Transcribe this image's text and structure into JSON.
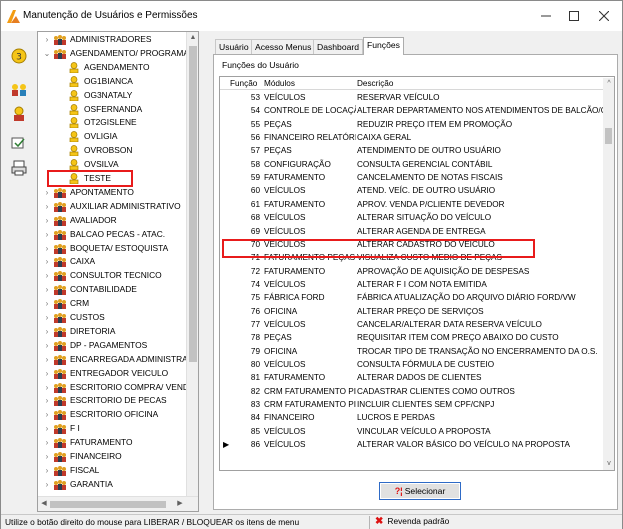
{
  "window": {
    "title": "Manutenção de Usuários e Permissões",
    "accent": "#f39c12"
  },
  "tree": {
    "items": [
      {
        "label": "ADMINISTRADORES",
        "level": 0,
        "state": "collapsed",
        "icon": "group-icon"
      },
      {
        "label": "AGENDAMENTO/ PROGRAMAD",
        "level": 0,
        "state": "expanded",
        "icon": "group-icon"
      },
      {
        "label": "AGENDAMENTO",
        "level": 1,
        "state": "leaf",
        "icon": "user-icon"
      },
      {
        "label": "OG1BIANCA",
        "level": 1,
        "state": "leaf",
        "icon": "user-icon"
      },
      {
        "label": "OG3NATALY",
        "level": 1,
        "state": "leaf",
        "icon": "user-icon"
      },
      {
        "label": "OSFERNANDA",
        "level": 1,
        "state": "leaf",
        "icon": "user-icon"
      },
      {
        "label": "OT2GISLENE",
        "level": 1,
        "state": "leaf",
        "icon": "user-icon"
      },
      {
        "label": "OVLIGIA",
        "level": 1,
        "state": "leaf",
        "icon": "user-icon"
      },
      {
        "label": "OVROBSON",
        "level": 1,
        "state": "leaf",
        "icon": "user-icon"
      },
      {
        "label": "OVSILVA",
        "level": 1,
        "state": "leaf",
        "icon": "user-icon"
      },
      {
        "label": "TESTE",
        "level": 1,
        "state": "leaf",
        "icon": "user-icon",
        "highlighted": true
      },
      {
        "label": "APONTAMENTO",
        "level": 0,
        "state": "collapsed",
        "icon": "group-icon"
      },
      {
        "label": "AUXILIAR ADMINISTRATIVO",
        "level": 0,
        "state": "collapsed",
        "icon": "group-icon"
      },
      {
        "label": "AVALIADOR",
        "level": 0,
        "state": "collapsed",
        "icon": "group-icon"
      },
      {
        "label": "BALCAO PECAS - ATAC.",
        "level": 0,
        "state": "collapsed",
        "icon": "group-icon"
      },
      {
        "label": "BOQUETA/ ESTOQUISTA",
        "level": 0,
        "state": "collapsed",
        "icon": "group-icon"
      },
      {
        "label": "CAIXA",
        "level": 0,
        "state": "collapsed",
        "icon": "group-icon"
      },
      {
        "label": "CONSULTOR TECNICO",
        "level": 0,
        "state": "collapsed",
        "icon": "group-icon"
      },
      {
        "label": "CONTABILIDADE",
        "level": 0,
        "state": "collapsed",
        "icon": "group-icon"
      },
      {
        "label": "CRM",
        "level": 0,
        "state": "collapsed",
        "icon": "group-icon"
      },
      {
        "label": "CUSTOS",
        "level": 0,
        "state": "collapsed",
        "icon": "group-icon"
      },
      {
        "label": "DIRETORIA",
        "level": 0,
        "state": "collapsed",
        "icon": "group-icon"
      },
      {
        "label": "DP - PAGAMENTOS",
        "level": 0,
        "state": "collapsed",
        "icon": "group-icon"
      },
      {
        "label": "ENCARREGADA ADMINISTRAT",
        "level": 0,
        "state": "collapsed",
        "icon": "group-icon"
      },
      {
        "label": "ENTREGADOR VEICULO",
        "level": 0,
        "state": "collapsed",
        "icon": "group-icon"
      },
      {
        "label": "ESCRITORIO COMPRA/ VENDA",
        "level": 0,
        "state": "collapsed",
        "icon": "group-icon"
      },
      {
        "label": "ESCRITORIO DE PECAS",
        "level": 0,
        "state": "collapsed",
        "icon": "group-icon"
      },
      {
        "label": "ESCRITORIO OFICINA",
        "level": 0,
        "state": "collapsed",
        "icon": "group-icon"
      },
      {
        "label": "F I",
        "level": 0,
        "state": "collapsed",
        "icon": "group-icon"
      },
      {
        "label": "FATURAMENTO",
        "level": 0,
        "state": "collapsed",
        "icon": "group-icon"
      },
      {
        "label": "FINANCEIRO",
        "level": 0,
        "state": "collapsed",
        "icon": "group-icon"
      },
      {
        "label": "FISCAL",
        "level": 0,
        "state": "collapsed",
        "icon": "group-icon"
      },
      {
        "label": "GARANTIA",
        "level": 0,
        "state": "collapsed",
        "icon": "group-icon"
      }
    ]
  },
  "tabs": [
    {
      "label": "Usuário",
      "active": false
    },
    {
      "label": "Acesso Menus",
      "active": false
    },
    {
      "label": "Dashboard",
      "active": false
    },
    {
      "label": "Funções",
      "active": true
    }
  ],
  "panel": {
    "title": "Funções do Usuário"
  },
  "grid": {
    "headers": {
      "num": "Função",
      "mod": "Módulos",
      "desc": "Descrição"
    },
    "rows": [
      {
        "num": "53",
        "mod": "VEÍCULOS",
        "desc": "RESERVAR VEÍCULO"
      },
      {
        "num": "54",
        "mod": "CONTROLE DE LOCAÇÃO",
        "desc": "ALTERAR DEPARTAMENTO NOS ATENDIMENTOS DE BALCÃO/OF"
      },
      {
        "num": "55",
        "mod": "PEÇAS",
        "desc": "REDUZIR PREÇO ITEM EM PROMOÇÃO"
      },
      {
        "num": "56",
        "mod": "FINANCEIRO RELATÓRIOS",
        "desc": "CAIXA GERAL"
      },
      {
        "num": "57",
        "mod": "PEÇAS",
        "desc": "ATENDIMENTO DE OUTRO USUÁRIO"
      },
      {
        "num": "58",
        "mod": "CONFIGURAÇÃO",
        "desc": "CONSULTA GERENCIAL CONTÁBIL"
      },
      {
        "num": "59",
        "mod": "FATURAMENTO",
        "desc": "CANCELAMENTO DE NOTAS FISCAIS"
      },
      {
        "num": "60",
        "mod": "VEÍCULOS",
        "desc": "ATEND. VEÍC. DE OUTRO USUÁRIO"
      },
      {
        "num": "61",
        "mod": "FATURAMENTO",
        "desc": "APROV. VENDA P/CLIENTE DEVEDOR"
      },
      {
        "num": "68",
        "mod": "VEÍCULOS",
        "desc": "ALTERAR SITUAÇÃO DO VEÍCULO"
      },
      {
        "num": "69",
        "mod": "VEÍCULOS",
        "desc": "ALTERAR AGENDA DE ENTREGA"
      },
      {
        "num": "70",
        "mod": "VEÍCULOS",
        "desc": "ALTERAR CADASTRO DO VEÍCULO",
        "highlighted": true
      },
      {
        "num": "71",
        "mod": "FATURAMENTO PEÇAS",
        "desc": "VISUALIZA CUSTO MEDIO DE PEÇAS"
      },
      {
        "num": "72",
        "mod": "FATURAMENTO",
        "desc": "APROVAÇÃO DE AQUISIÇÃO DE DESPESAS"
      },
      {
        "num": "74",
        "mod": "VEÍCULOS",
        "desc": "ALTERAR F I COM NOTA EMITIDA"
      },
      {
        "num": "75",
        "mod": "FÁBRICA FORD",
        "desc": "FÁBRICA ATUALIZAÇÃO DO ARQUIVO DIÁRIO FORD/VW"
      },
      {
        "num": "76",
        "mod": "OFICINA",
        "desc": "ALTERAR PREÇO DE SERVIÇOS"
      },
      {
        "num": "77",
        "mod": "VEÍCULOS",
        "desc": "CANCELAR/ALTERAR DATA RESERVA VEÍCULO"
      },
      {
        "num": "78",
        "mod": "PEÇAS",
        "desc": "REQUISITAR ITEM COM PREÇO ABAIXO DO CUSTO"
      },
      {
        "num": "79",
        "mod": "OFICINA",
        "desc": "TROCAR TIPO DE TRANSAÇÃO NO ENCERRAMENTO DA O.S."
      },
      {
        "num": "80",
        "mod": "VEÍCULOS",
        "desc": "CONSULTA FÓRMULA DE CUSTEIO"
      },
      {
        "num": "81",
        "mod": "FATURAMENTO",
        "desc": "ALTERAR DADOS DE CLIENTES"
      },
      {
        "num": "82",
        "mod": "CRM FATURAMENTO PI",
        "desc": "CADASTRAR CLIENTES COMO OUTROS"
      },
      {
        "num": "83",
        "mod": "CRM FATURAMENTO PI",
        "desc": "INCLUIR CLIENTES SEM CPF/CNPJ"
      },
      {
        "num": "84",
        "mod": "FINANCEIRO",
        "desc": "LUCROS E PERDAS"
      },
      {
        "num": "85",
        "mod": "VEÍCULOS",
        "desc": "VINCULAR VEÍCULO A PROPOSTA"
      },
      {
        "num": "86",
        "mod": "VEÍCULOS",
        "desc": "ALTERAR VALOR BÁSICO DO VEÍCULO NA PROPOSTA",
        "current": true
      }
    ]
  },
  "select_button": {
    "label": "Selecionar",
    "icon": "question-icon"
  },
  "statusbar": {
    "hint": "Utilize o botão direito do mouse para LIBERAR / BLOQUEAR os itens de menu",
    "profile": "Revenda padrão"
  },
  "highlight_color": "#e81b1b"
}
